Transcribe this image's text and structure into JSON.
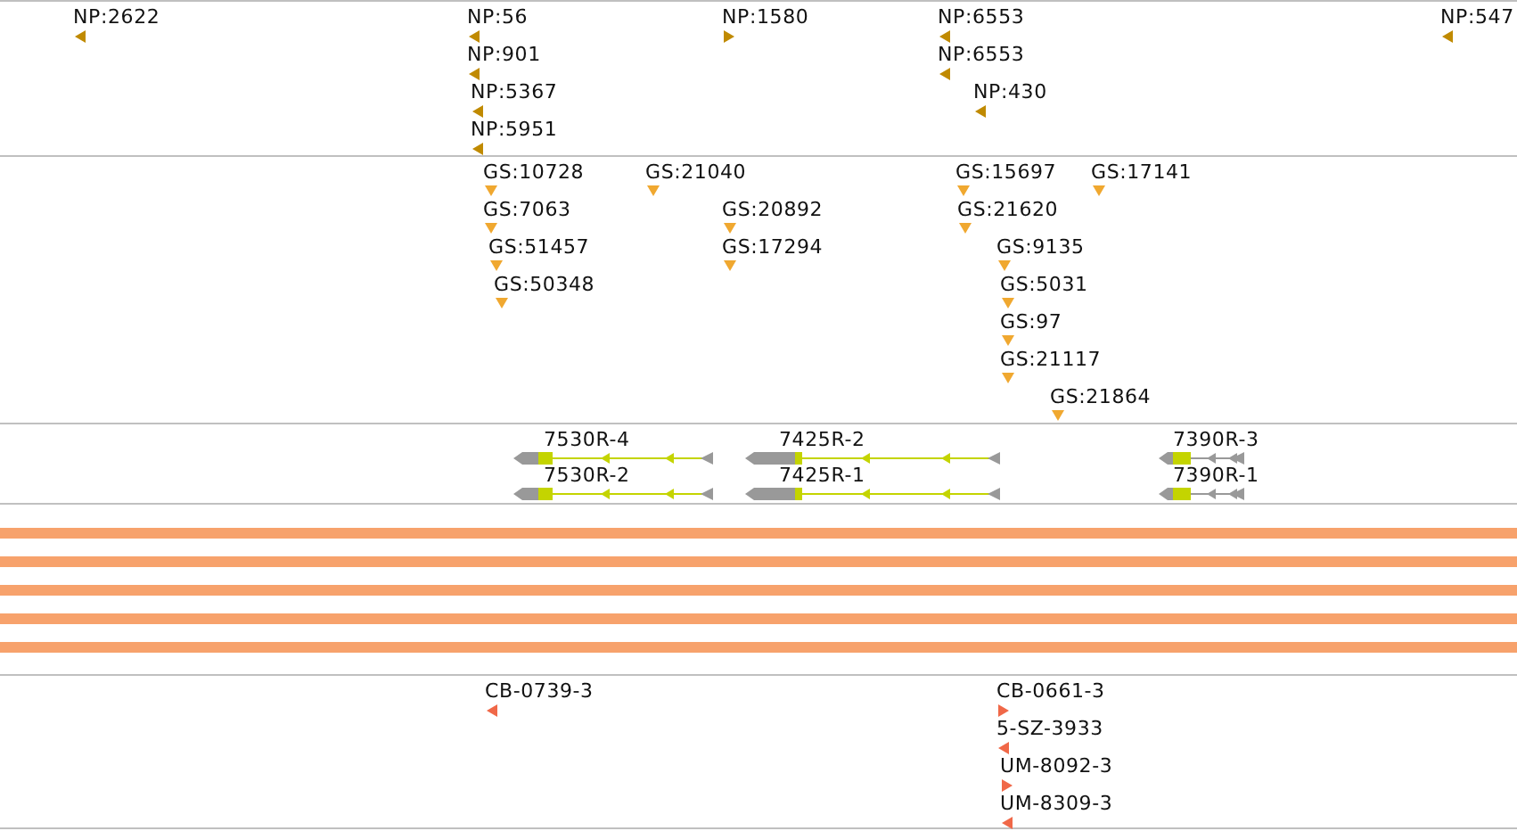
{
  "tracks": [
    {
      "kind": "stranded",
      "color": "#c08a00",
      "features": [
        {
          "label": "NP:2622",
          "reverse": true
        },
        {
          "label": "NP:56",
          "reverse": true
        },
        {
          "label": "NP:901",
          "reverse": true
        },
        {
          "label": "NP:5367",
          "reverse": true
        },
        {
          "label": "NP:5951",
          "reverse": true
        },
        {
          "label": "NP:1580",
          "reverse": false
        },
        {
          "label": "NP:6553",
          "reverse": true
        },
        {
          "label": "NP:6553",
          "reverse": true
        },
        {
          "label": "NP:430",
          "reverse": true
        },
        {
          "label": "NP:547",
          "reverse": true
        }
      ]
    },
    {
      "kind": "point",
      "color": "#f0a830",
      "features": [
        {
          "label": "GS:10728"
        },
        {
          "label": "GS:21040"
        },
        {
          "label": "GS:15697"
        },
        {
          "label": "GS:17141"
        },
        {
          "label": "GS:7063"
        },
        {
          "label": "GS:20892"
        },
        {
          "label": "GS:21620"
        },
        {
          "label": "GS:51457"
        },
        {
          "label": "GS:17294"
        },
        {
          "label": "GS:9135"
        },
        {
          "label": "GS:50348"
        },
        {
          "label": "GS:5031"
        },
        {
          "label": "GS:97"
        },
        {
          "label": "GS:21117"
        },
        {
          "label": "GS:21864"
        }
      ]
    },
    {
      "kind": "transcripts",
      "color": "#c4d400",
      "features": [
        {
          "label": "7530R-4"
        },
        {
          "label": "7530R-2"
        },
        {
          "label": "7425R-2"
        },
        {
          "label": "7425R-1"
        },
        {
          "label": "7390R-3"
        },
        {
          "label": "7390R-1"
        }
      ]
    },
    {
      "kind": "bars",
      "bars": [
        {
          "color": "#f7a26c"
        },
        {
          "color": "#f7a26c"
        },
        {
          "color": "#f7a26c"
        },
        {
          "color": "#f7a26c"
        },
        {
          "color": "#f7a26c"
        }
      ]
    },
    {
      "kind": "stranded",
      "color": "#f06848",
      "features": [
        {
          "label": "CB-0739-3",
          "reverse": true
        },
        {
          "label": "CB-0661-3",
          "reverse": false
        },
        {
          "label": "5-SZ-3933",
          "reverse": true
        },
        {
          "label": "UM-8092-3",
          "reverse": false
        },
        {
          "label": "UM-8309-3",
          "reverse": true
        }
      ]
    }
  ]
}
